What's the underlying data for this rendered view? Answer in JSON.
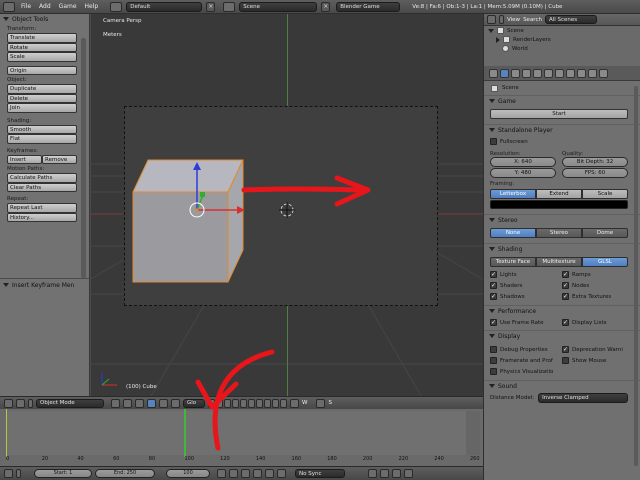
{
  "topbar": {
    "menus": [
      "File",
      "Add",
      "Game",
      "Help"
    ],
    "screen_layout": "Default",
    "scene": "Scene",
    "engine": "Blender Game",
    "stats": "Ve:8 | Fa:6 | Ob:1-3 | La:1 | Mem:5.09M (0.10M) | Cube"
  },
  "toolshelf": {
    "title": "Object Tools",
    "transform_label": "Transform:",
    "transform_buttons": [
      "Translate",
      "Rotate",
      "Scale"
    ],
    "origin_button": "Origin",
    "object_label": "Object:",
    "object_buttons": [
      "Duplicate",
      "Delete",
      "Join"
    ],
    "shading_label": "Shading:",
    "shading_buttons": [
      "Smooth",
      "Flat"
    ],
    "keyframes_label": "Keyframes:",
    "insert_button": "Insert",
    "remove_button": "Remove",
    "motion_paths_label": "Motion Paths:",
    "motion_buttons": [
      "Calculate Paths",
      "Clear Paths"
    ],
    "repeat_label": "Repeat:",
    "repeat_buttons": [
      "Repeat Last",
      "History..."
    ],
    "insert_keyframe_menu": "Insert Keyframe Men"
  },
  "viewport": {
    "view_name": "Camera Persp",
    "units": "Meters",
    "status": "(100) Cube"
  },
  "vp_header": {
    "mode": "Object Mode",
    "orientation": "Glo",
    "layer_w": "W",
    "layer_s": "S"
  },
  "timeline": {
    "ticks": [
      "0",
      "20",
      "40",
      "60",
      "80",
      "100",
      "120",
      "140",
      "160",
      "180",
      "200",
      "220",
      "240",
      "260"
    ],
    "current_frame_value": 100,
    "frame_range_max": 260
  },
  "tl_footer": {
    "start": "Start: 1",
    "end": "End: 250",
    "current": "100",
    "sync": "No Sync"
  },
  "outliner": {
    "view_label": "View",
    "search_label": "Search",
    "scenes_dropdown": "All Scenes",
    "rows": [
      "Scene",
      "RenderLayers",
      "World"
    ]
  },
  "props": {
    "crumb": "Scene",
    "game_title": "Game",
    "start_button": "Start",
    "standalone_title": "Standalone Player",
    "fullscreen": "Fullscreen",
    "resolution_label": "Resolution:",
    "quality_label": "Quality:",
    "res_x": "X: 640",
    "res_y": "Y: 480",
    "bit_depth": "Bit Depth: 32",
    "fps": "FPS: 60",
    "framing_label": "Framing:",
    "framing_options": [
      "Letterbox",
      "Extend",
      "Scale"
    ],
    "stereo_title": "Stereo",
    "stereo_options": [
      "None",
      "Stereo",
      "Dome"
    ],
    "shading_title": "Shading",
    "shading_options": [
      "Texture Face",
      "Multitexture",
      "GLSL"
    ],
    "shading_checks_left": [
      "Lights",
      "Shaders",
      "Shadows"
    ],
    "shading_checks_right": [
      "Ramps",
      "Nodes",
      "Extra Textures"
    ],
    "performance_title": "Performance",
    "use_frame_rate": "Use Frame Rate",
    "display_lists": "Display Lists",
    "display_title": "Display",
    "display_checks_left": [
      "Debug Properties",
      "Framerate and Prof",
      "Physics Visualizatio"
    ],
    "display_checks_right": [
      "Deprecation Warni",
      "Show Mouse"
    ],
    "sound_title": "Sound",
    "distance_model_label": "Distance Model:",
    "distance_model_value": "Inverse Clamped"
  },
  "colors": {
    "accent_blue": "#5784c0",
    "annotation_red": "#e8151b",
    "selection_orange": "#e28a2c"
  }
}
